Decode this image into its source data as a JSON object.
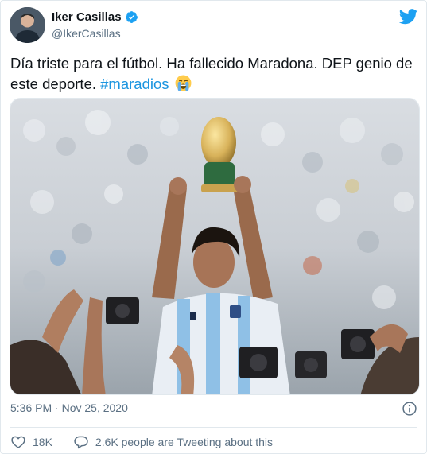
{
  "author": {
    "name": "Iker Casillas",
    "handle": "@IkerCasillas"
  },
  "tweet": {
    "text": "Día triste para el fútbol. Ha fallecido Maradona. DEP genio de este deporte.",
    "hashtag": "#maradios",
    "emoji": "crying-face-emoji",
    "timestamp": "5:36 PM · Nov 25, 2020"
  },
  "stats": {
    "likes": "18K",
    "conversation": "2.6K people are Tweeting about this"
  },
  "icons": {
    "brand": "twitter-bird-icon",
    "verified": "verified-badge-icon",
    "like": "heart-icon",
    "reply": "speech-bubble-icon",
    "info": "info-icon"
  },
  "colors": {
    "accent": "#1da1f2",
    "hashtag": "#1b95e0",
    "secondary_text": "#5b7083"
  }
}
